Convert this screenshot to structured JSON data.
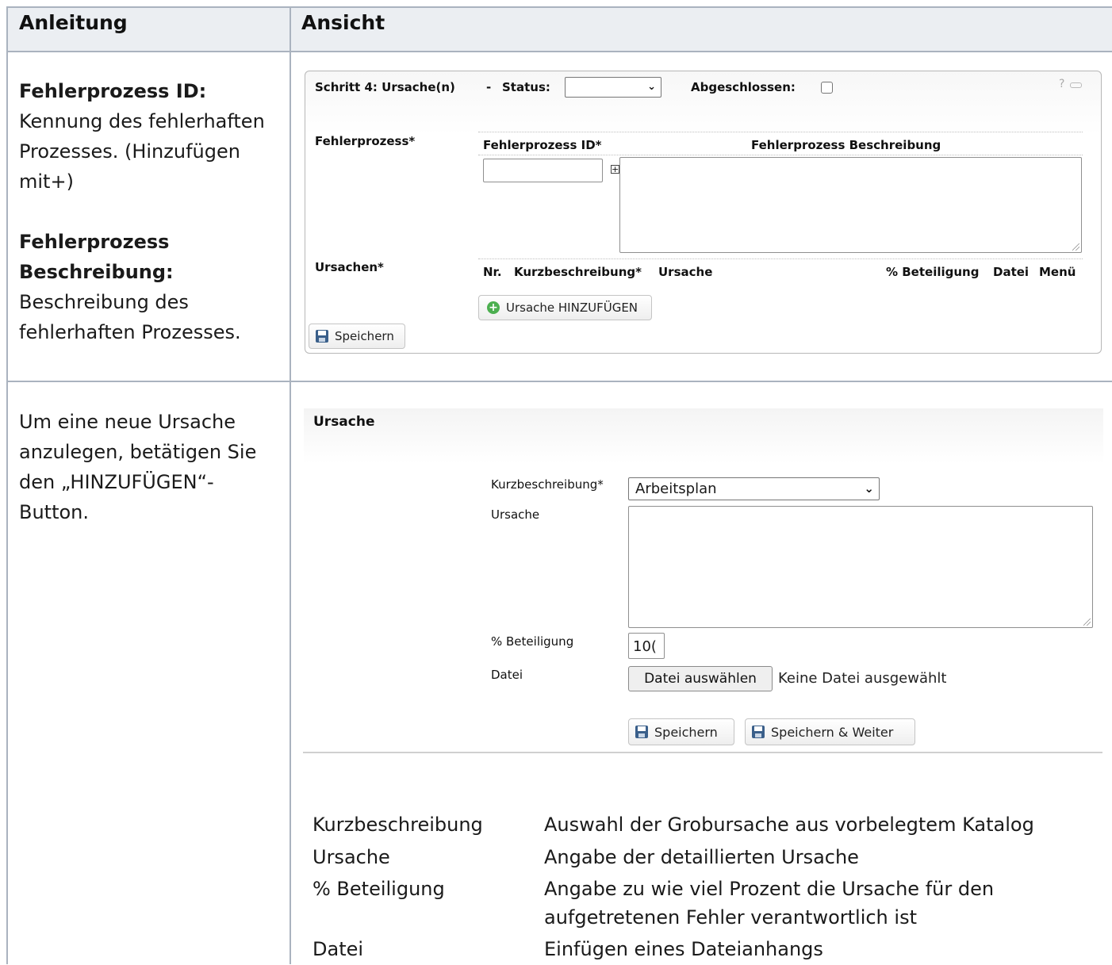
{
  "table": {
    "header_left": "Anleitung",
    "header_right": "Ansicht"
  },
  "row1": {
    "left": {
      "h1": "Fehlerprozess ID:",
      "p1": [
        "Kennung des fehlerhaften",
        "Prozesses. (Hinzufügen",
        "mit+)"
      ],
      "h2a": "Fehlerprozess",
      "h2b": "Beschreibung:",
      "p2": [
        "Beschreibung des",
        "fehlerhaften Prozesses."
      ]
    },
    "panel": {
      "title": "Schritt 4: Ursache(n)",
      "dash": "-",
      "status_label": "Status:",
      "status_value": "",
      "closed_label": "Abgeschlossen:",
      "help": "?",
      "fehlerprozess_label": "Fehlerprozess*",
      "col_id": "Fehlerprozess ID*",
      "col_desc": "Fehlerprozess Beschreibung",
      "id_value": "",
      "desc_value": "",
      "ursachen_label": "Ursachen*",
      "cols": [
        "Nr.",
        "Kurzbeschreibung*",
        "Ursache",
        "% Beteiligung",
        "Datei",
        "Menü"
      ],
      "add_button": "Ursache HINZUFÜGEN",
      "save_button": "Speichern"
    }
  },
  "row2": {
    "left": [
      "Um eine neue Ursache",
      "anzulegen, betätigen Sie",
      "den „HINZUFÜGEN“-",
      "Button."
    ],
    "dialog": {
      "title": "Ursache",
      "kurz_label": "Kurzbeschreibung*",
      "kurz_value": "Arbeitsplan",
      "ursache_label": "Ursache",
      "ursache_value": "",
      "beteiligung_label": "% Beteiligung",
      "beteiligung_value": "10(",
      "datei_label": "Datei",
      "file_button": "Datei auswählen",
      "file_status": "Keine Datei ausgewählt",
      "save_button": "Speichern",
      "save_next_button": "Speichern & Weiter"
    },
    "descriptions": [
      {
        "term": "Kurzbeschreibung",
        "def": [
          "Auswahl der Grobursache aus vorbelegtem Katalog"
        ]
      },
      {
        "term": "Ursache",
        "def": [
          "Angabe der detaillierten Ursache"
        ]
      },
      {
        "term": "% Beteiligung",
        "def": [
          "Angabe zu wie viel Prozent die Ursache für den",
          "aufgetretenen Fehler verantwortlich ist"
        ]
      },
      {
        "term": "Datei",
        "def": [
          "Einfügen eines Dateianhangs"
        ]
      }
    ]
  }
}
